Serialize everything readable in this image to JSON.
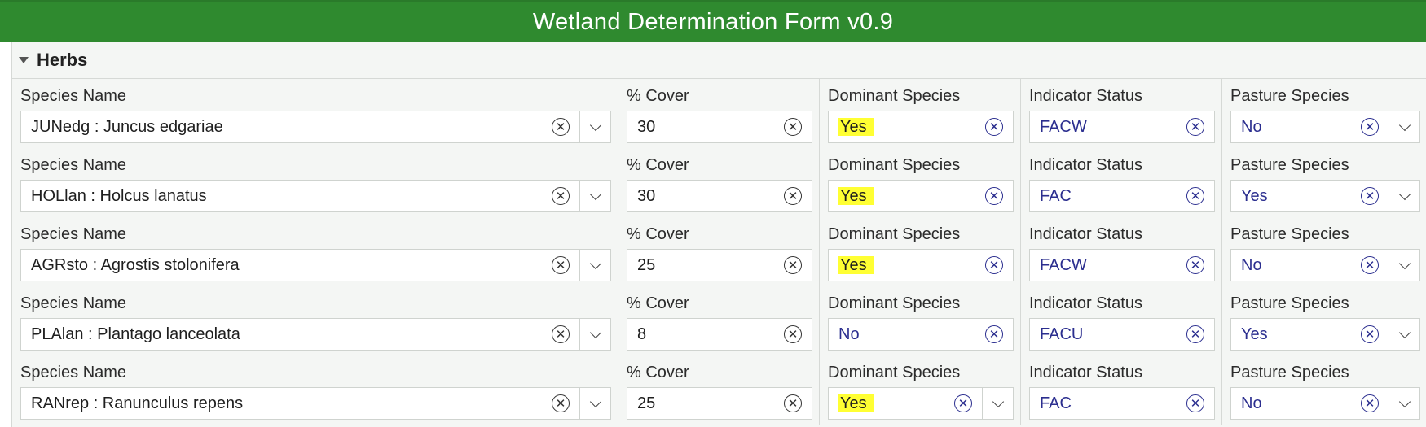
{
  "title": "Wetland Determination Form v0.9",
  "group": {
    "label": "Herbs"
  },
  "labels": {
    "species": "Species Name",
    "cover": "% Cover",
    "dominant": "Dominant Species",
    "indicator": "Indicator Status",
    "pasture": "Pasture Species"
  },
  "rows": [
    {
      "species": "JUNedg : Juncus edgariae",
      "cover": "30",
      "dominant": "Yes",
      "indicator": "FACW",
      "pasture": "No"
    },
    {
      "species": "HOLlan : Holcus lanatus",
      "cover": "30",
      "dominant": "Yes",
      "indicator": "FAC",
      "pasture": "Yes"
    },
    {
      "species": "AGRsto : Agrostis stolonifera",
      "cover": "25",
      "dominant": "Yes",
      "indicator": "FACW",
      "pasture": "No"
    },
    {
      "species": "PLAlan : Plantago lanceolata",
      "cover": "8",
      "dominant": "No",
      "indicator": "FACU",
      "pasture": "Yes"
    },
    {
      "species": "RANrep : Ranunculus repens",
      "cover": "25",
      "dominant": "Yes",
      "indicator": "FAC",
      "pasture": "No"
    }
  ],
  "icons": {
    "clear": "clear-circle-x-icon",
    "dropdown": "chevron-down-icon",
    "collapse": "caret-down-icon"
  },
  "colors": {
    "header": "#2f8a2f",
    "choice_text": "#2b2e8f",
    "highlight": "#ffff33"
  }
}
